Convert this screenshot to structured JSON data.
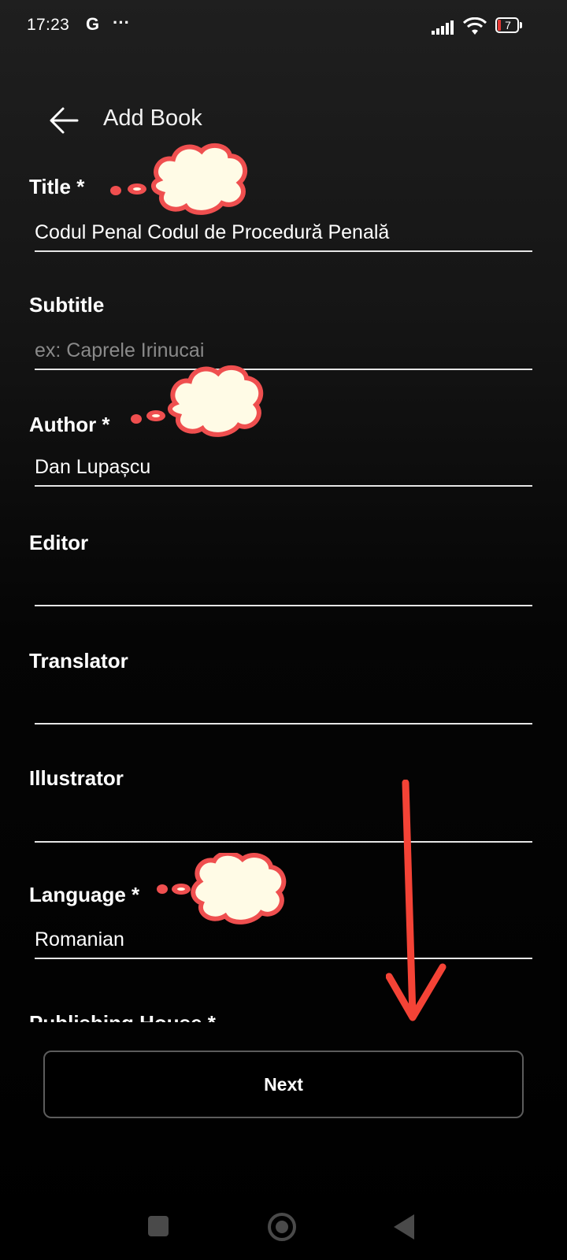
{
  "status_bar": {
    "time": "17:23",
    "g_label": "G",
    "more": "···",
    "battery_level": "7",
    "battery_color": "#e53935"
  },
  "app_bar": {
    "back_icon": "arrow-left-icon",
    "title": "Add Book"
  },
  "form": {
    "title": {
      "label": "Title *",
      "value": "Codul Penal Codul de Procedură Penală",
      "placeholder": ""
    },
    "subtitle": {
      "label": "Subtitle",
      "value": "",
      "placeholder": "ex: Caprele Irinucai"
    },
    "author": {
      "label": "Author *",
      "value": "Dan Lupașcu",
      "placeholder": ""
    },
    "editor": {
      "label": "Editor",
      "value": "",
      "placeholder": ""
    },
    "translator": {
      "label": "Translator",
      "value": "",
      "placeholder": ""
    },
    "illustrator": {
      "label": "Illustrator",
      "value": "",
      "placeholder": ""
    },
    "language": {
      "label": "Language *",
      "value": "Romanian",
      "placeholder": ""
    },
    "publishing_house": {
      "label": "Publishing House *"
    }
  },
  "next_button": {
    "label": "Next"
  },
  "annotations": {
    "cloud_fill": "#fffbe6",
    "cloud_stroke": "#ef4f4f",
    "arrow_color": "#f44336"
  },
  "nav_bar": {
    "recents_icon": "square-icon",
    "home_icon": "circle-icon",
    "back_icon": "triangle-back-icon"
  }
}
